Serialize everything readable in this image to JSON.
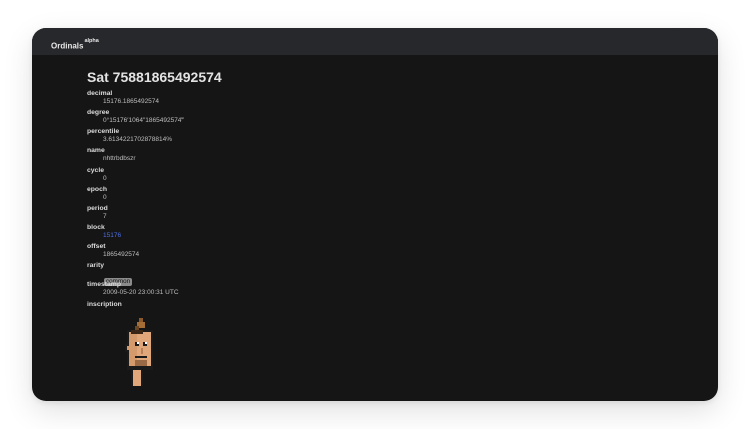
{
  "nav": {
    "brand": "Ordinals",
    "brand_tag": "alpha"
  },
  "page": {
    "title": "Sat 75881865492574"
  },
  "fields": {
    "decimal": {
      "label": "decimal",
      "value": "15176.1865492574"
    },
    "degree": {
      "label": "degree",
      "value": "0°15176′1064″1865492574‴"
    },
    "percentile": {
      "label": "percentile",
      "value": "3.6134221702878814%"
    },
    "name": {
      "label": "name",
      "value": "nhttrbdbszr"
    },
    "cycle": {
      "label": "cycle",
      "value": "0"
    },
    "epoch": {
      "label": "epoch",
      "value": "0"
    },
    "period": {
      "label": "period",
      "value": "7"
    },
    "block": {
      "label": "block",
      "value": "15176"
    },
    "offset": {
      "label": "offset",
      "value": "1865492574"
    },
    "rarity": {
      "label": "rarity",
      "value": "common"
    },
    "timestamp": {
      "label": "timestamp",
      "value": "2009-05-20 23:00:31 UTC"
    },
    "inscription": {
      "label": "inscription"
    }
  },
  "inscription_image": {
    "description_icon": "pixel-punk-icon"
  }
}
